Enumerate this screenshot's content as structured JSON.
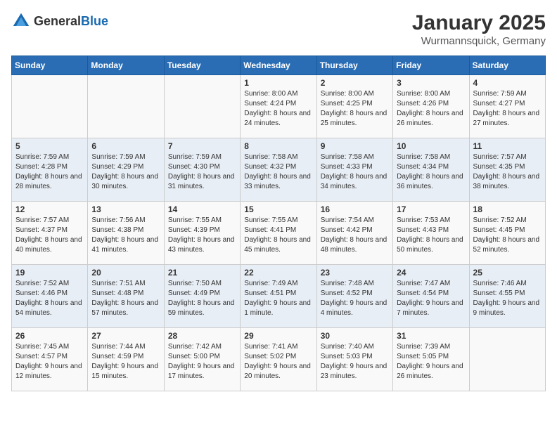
{
  "header": {
    "logo_general": "General",
    "logo_blue": "Blue",
    "main_title": "January 2025",
    "subtitle": "Wurmannsquick, Germany"
  },
  "days_of_week": [
    "Sunday",
    "Monday",
    "Tuesday",
    "Wednesday",
    "Thursday",
    "Friday",
    "Saturday"
  ],
  "weeks": [
    [
      {
        "day": "",
        "info": ""
      },
      {
        "day": "",
        "info": ""
      },
      {
        "day": "",
        "info": ""
      },
      {
        "day": "1",
        "info": "Sunrise: 8:00 AM\nSunset: 4:24 PM\nDaylight: 8 hours and 24 minutes."
      },
      {
        "day": "2",
        "info": "Sunrise: 8:00 AM\nSunset: 4:25 PM\nDaylight: 8 hours and 25 minutes."
      },
      {
        "day": "3",
        "info": "Sunrise: 8:00 AM\nSunset: 4:26 PM\nDaylight: 8 hours and 26 minutes."
      },
      {
        "day": "4",
        "info": "Sunrise: 7:59 AM\nSunset: 4:27 PM\nDaylight: 8 hours and 27 minutes."
      }
    ],
    [
      {
        "day": "5",
        "info": "Sunrise: 7:59 AM\nSunset: 4:28 PM\nDaylight: 8 hours and 28 minutes."
      },
      {
        "day": "6",
        "info": "Sunrise: 7:59 AM\nSunset: 4:29 PM\nDaylight: 8 hours and 30 minutes."
      },
      {
        "day": "7",
        "info": "Sunrise: 7:59 AM\nSunset: 4:30 PM\nDaylight: 8 hours and 31 minutes."
      },
      {
        "day": "8",
        "info": "Sunrise: 7:58 AM\nSunset: 4:32 PM\nDaylight: 8 hours and 33 minutes."
      },
      {
        "day": "9",
        "info": "Sunrise: 7:58 AM\nSunset: 4:33 PM\nDaylight: 8 hours and 34 minutes."
      },
      {
        "day": "10",
        "info": "Sunrise: 7:58 AM\nSunset: 4:34 PM\nDaylight: 8 hours and 36 minutes."
      },
      {
        "day": "11",
        "info": "Sunrise: 7:57 AM\nSunset: 4:35 PM\nDaylight: 8 hours and 38 minutes."
      }
    ],
    [
      {
        "day": "12",
        "info": "Sunrise: 7:57 AM\nSunset: 4:37 PM\nDaylight: 8 hours and 40 minutes."
      },
      {
        "day": "13",
        "info": "Sunrise: 7:56 AM\nSunset: 4:38 PM\nDaylight: 8 hours and 41 minutes."
      },
      {
        "day": "14",
        "info": "Sunrise: 7:55 AM\nSunset: 4:39 PM\nDaylight: 8 hours and 43 minutes."
      },
      {
        "day": "15",
        "info": "Sunrise: 7:55 AM\nSunset: 4:41 PM\nDaylight: 8 hours and 45 minutes."
      },
      {
        "day": "16",
        "info": "Sunrise: 7:54 AM\nSunset: 4:42 PM\nDaylight: 8 hours and 48 minutes."
      },
      {
        "day": "17",
        "info": "Sunrise: 7:53 AM\nSunset: 4:43 PM\nDaylight: 8 hours and 50 minutes."
      },
      {
        "day": "18",
        "info": "Sunrise: 7:52 AM\nSunset: 4:45 PM\nDaylight: 8 hours and 52 minutes."
      }
    ],
    [
      {
        "day": "19",
        "info": "Sunrise: 7:52 AM\nSunset: 4:46 PM\nDaylight: 8 hours and 54 minutes."
      },
      {
        "day": "20",
        "info": "Sunrise: 7:51 AM\nSunset: 4:48 PM\nDaylight: 8 hours and 57 minutes."
      },
      {
        "day": "21",
        "info": "Sunrise: 7:50 AM\nSunset: 4:49 PM\nDaylight: 8 hours and 59 minutes."
      },
      {
        "day": "22",
        "info": "Sunrise: 7:49 AM\nSunset: 4:51 PM\nDaylight: 9 hours and 1 minute."
      },
      {
        "day": "23",
        "info": "Sunrise: 7:48 AM\nSunset: 4:52 PM\nDaylight: 9 hours and 4 minutes."
      },
      {
        "day": "24",
        "info": "Sunrise: 7:47 AM\nSunset: 4:54 PM\nDaylight: 9 hours and 7 minutes."
      },
      {
        "day": "25",
        "info": "Sunrise: 7:46 AM\nSunset: 4:55 PM\nDaylight: 9 hours and 9 minutes."
      }
    ],
    [
      {
        "day": "26",
        "info": "Sunrise: 7:45 AM\nSunset: 4:57 PM\nDaylight: 9 hours and 12 minutes."
      },
      {
        "day": "27",
        "info": "Sunrise: 7:44 AM\nSunset: 4:59 PM\nDaylight: 9 hours and 15 minutes."
      },
      {
        "day": "28",
        "info": "Sunrise: 7:42 AM\nSunset: 5:00 PM\nDaylight: 9 hours and 17 minutes."
      },
      {
        "day": "29",
        "info": "Sunrise: 7:41 AM\nSunset: 5:02 PM\nDaylight: 9 hours and 20 minutes."
      },
      {
        "day": "30",
        "info": "Sunrise: 7:40 AM\nSunset: 5:03 PM\nDaylight: 9 hours and 23 minutes."
      },
      {
        "day": "31",
        "info": "Sunrise: 7:39 AM\nSunset: 5:05 PM\nDaylight: 9 hours and 26 minutes."
      },
      {
        "day": "",
        "info": ""
      }
    ]
  ]
}
